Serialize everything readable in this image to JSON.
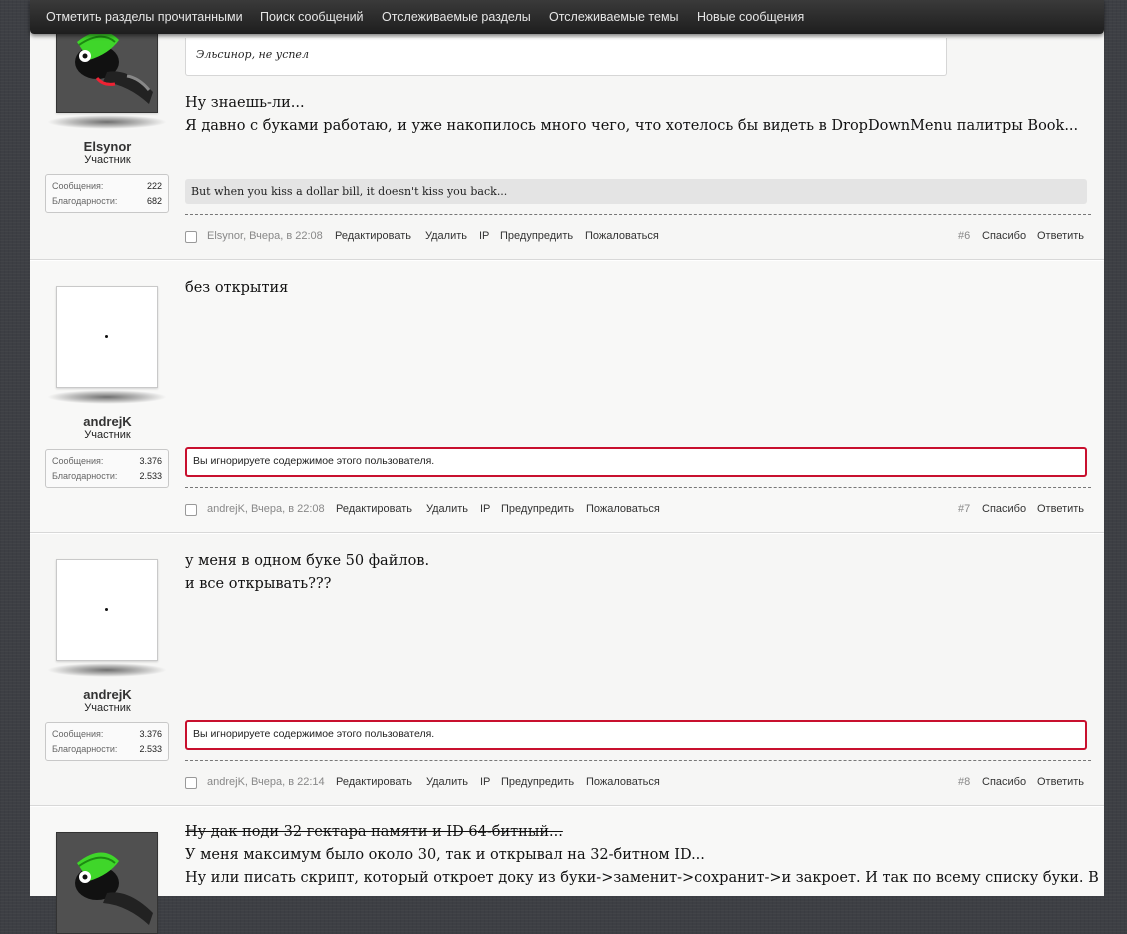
{
  "nav": {
    "items": [
      "Отметить разделы прочитанными",
      "Поиск сообщений",
      "Отслеживаемые разделы",
      "Отслеживаемые темы",
      "Новые сообщения"
    ]
  },
  "actions": {
    "edit": "Редактировать",
    "delete": "Удалить",
    "ip": "IP",
    "warn": "Предупредить",
    "report": "Пожаловаться",
    "thanks": "Спасибо",
    "reply": "Ответить"
  },
  "stat_labels": {
    "posts": "Сообщения:",
    "thanks": "Благодарности:"
  },
  "ignored_text": "Вы игнорируете содержимое этого пользователя.",
  "posts": [
    {
      "user": "Elsynor",
      "title": "Участник",
      "posts_count": "222",
      "thanks_count": "682",
      "quote": "Эльсинор, не успел",
      "lines": [
        "Ну знаешь-ли...",
        "Я давно с буками работаю, и уже накопилось много чего, что хотелось бы видеть в DropDownMenu палитры Book..."
      ],
      "signature": "But when you kiss a dollar bill, it doesn't kiss you back...",
      "meta": "Elsynor, Вчера, в 22:08",
      "number": "#6"
    },
    {
      "user": "andrejK",
      "title": "Участник",
      "posts_count": "3.376",
      "thanks_count": "2.533",
      "lines": [
        "без открытия"
      ],
      "meta": "andrejK, Вчера, в 22:08",
      "number": "#7"
    },
    {
      "user": "andrejK",
      "title": "Участник",
      "posts_count": "3.376",
      "thanks_count": "2.533",
      "lines": [
        "у меня в одном буке 50 файлов.",
        "и все открывать???"
      ],
      "meta": "andrejK, Вчера, в 22:14",
      "number": "#8"
    },
    {
      "strike_line": "Ну дак поди 32 гектара памяти и ID 64-битный...",
      "lines": [
        "У меня максимум было около 30, так и открывал на 32-битном ID...",
        "Ну или писать скрипт, который откроет доку из буки->заменит->сохранит->и закроет. И так по всему списку буки. В"
      ]
    }
  ]
}
